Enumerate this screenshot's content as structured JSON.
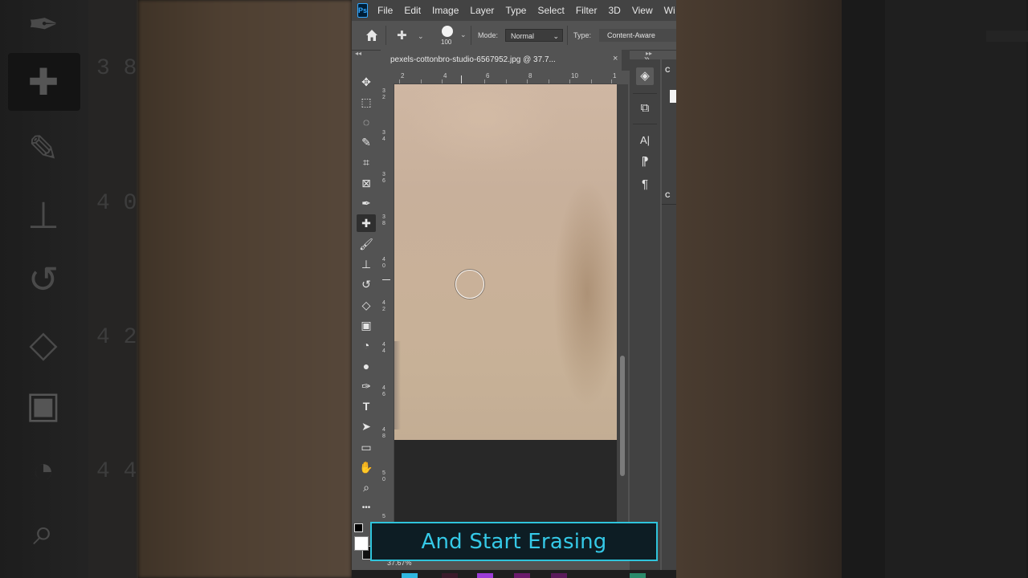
{
  "menu": {
    "logo": "Ps",
    "items": [
      "File",
      "Edit",
      "Image",
      "Layer",
      "Type",
      "Select",
      "Filter",
      "3D",
      "View",
      "Wi"
    ]
  },
  "options": {
    "brush_size": "100",
    "mode_label": "Mode:",
    "mode_value": "Normal",
    "type_label": "Type:",
    "type_value": "Content-Aware"
  },
  "document": {
    "tab_title": "pexels-cottonbro-studio-6567952.jpg @ 37.7...",
    "close_glyph": "×",
    "collapse_glyph": "»",
    "zoom": "37.67%"
  },
  "rulers": {
    "top": [
      "2",
      "4",
      "6",
      "8",
      "10",
      "1"
    ],
    "left": [
      "3\n2",
      "3\n4",
      "3\n6",
      "3\n8",
      "4\n0",
      "4\n2",
      "4\n4",
      "4\n6",
      "4\n8",
      "5\n0",
      "5"
    ]
  },
  "tools": [
    {
      "name": "move-tool",
      "glyph": "✥"
    },
    {
      "name": "marquee-tool",
      "glyph": "⬚"
    },
    {
      "name": "lasso-tool",
      "glyph": "◌"
    },
    {
      "name": "quick-selection-tool",
      "glyph": "✎"
    },
    {
      "name": "crop-tool",
      "glyph": "⌗"
    },
    {
      "name": "frame-tool",
      "glyph": "⊠"
    },
    {
      "name": "eyedropper-tool",
      "glyph": "✒"
    },
    {
      "name": "spot-healing-brush-tool",
      "glyph": "✚"
    },
    {
      "name": "brush-tool",
      "glyph": "🖌"
    },
    {
      "name": "clone-stamp-tool",
      "glyph": "⊥"
    },
    {
      "name": "history-brush-tool",
      "glyph": "↺"
    },
    {
      "name": "eraser-tool",
      "glyph": "◇"
    },
    {
      "name": "gradient-tool",
      "glyph": "▣"
    },
    {
      "name": "blur-tool",
      "glyph": "◔"
    },
    {
      "name": "dodge-tool",
      "glyph": "●"
    },
    {
      "name": "pen-tool",
      "glyph": "✑"
    },
    {
      "name": "type-tool",
      "glyph": "T"
    },
    {
      "name": "path-selection-tool",
      "glyph": "➤"
    },
    {
      "name": "rectangle-tool",
      "glyph": "▭"
    },
    {
      "name": "hand-tool",
      "glyph": "✋"
    },
    {
      "name": "zoom-tool",
      "glyph": "⌕"
    },
    {
      "name": "more-tools",
      "glyph": "•••"
    }
  ],
  "panels": [
    {
      "name": "layers-panel-icon",
      "glyph": "◈"
    },
    {
      "name": "adjustments-panel-icon",
      "glyph": "⧉"
    },
    {
      "name": "character-panel-icon",
      "glyph": "A|"
    },
    {
      "name": "glyphs-panel-icon",
      "glyph": "⁋"
    },
    {
      "name": "paragraph-panel-icon",
      "glyph": "¶"
    }
  ],
  "side_panel": {
    "label_top": "C",
    "label_mid": "C"
  },
  "colors": {
    "caption_border": "#2fc4dc",
    "caption_text": "#35c9e7",
    "ps_blue": "#31a8ff",
    "task_icons": [
      "#2fb7e0",
      "#3a1a2a",
      "#9b3bd6",
      "#6a1a6a",
      "#5a1a5a",
      "#2a8a6a"
    ]
  },
  "caption": "And Start Erasing"
}
